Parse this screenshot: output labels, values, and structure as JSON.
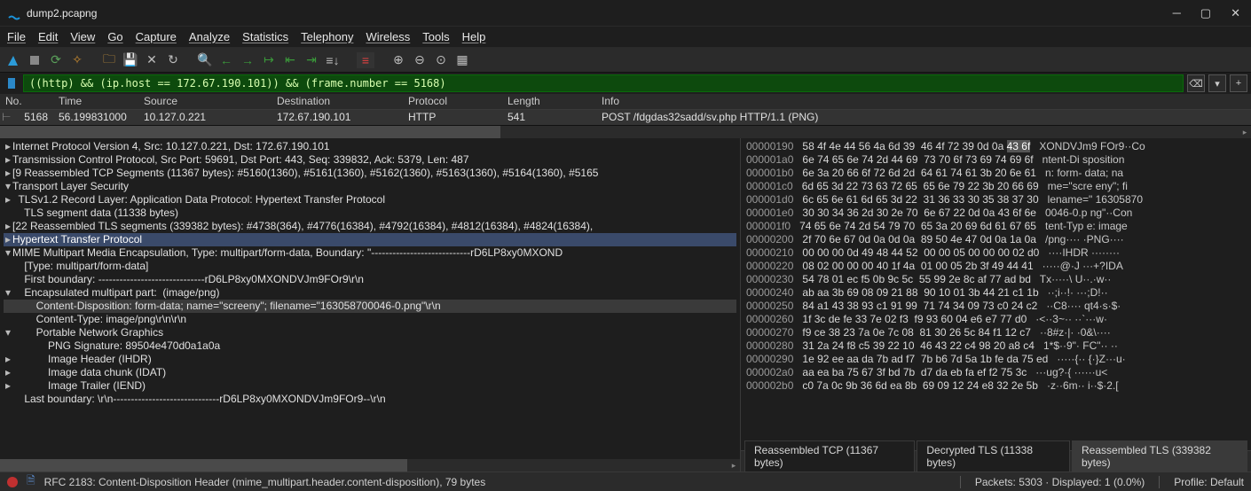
{
  "title": "dump2.pcapng",
  "menu": [
    "File",
    "Edit",
    "View",
    "Go",
    "Capture",
    "Analyze",
    "Statistics",
    "Telephony",
    "Wireless",
    "Tools",
    "Help"
  ],
  "filter": "((http) && (ip.host == 172.67.190.101)) && (frame.number == 5168)",
  "columns": [
    "No.",
    "Time",
    "Source",
    "Destination",
    "Protocol",
    "Length",
    "Info"
  ],
  "packetrow": {
    "no": "5168",
    "time": "56.199831000",
    "src": "10.127.0.221",
    "dst": "172.67.190.101",
    "proto": "HTTP",
    "len": "541",
    "info": "POST /fdgdas32sadd/sv.php HTTP/1.1   (PNG)"
  },
  "detail_lines": [
    {
      "twist": "▸",
      "indent": 0,
      "text": "Internet Protocol Version 4, Src: 10.127.0.221, Dst: 172.67.190.101",
      "cls": ""
    },
    {
      "twist": "▸",
      "indent": 0,
      "text": "Transmission Control Protocol, Src Port: 59691, Dst Port: 443, Seq: 339832, Ack: 5379, Len: 487",
      "cls": ""
    },
    {
      "twist": "▸",
      "indent": 0,
      "text": "[9 Reassembled TCP Segments (11367 bytes): #5160(1360), #5161(1360), #5162(1360), #5163(1360), #5164(1360), #5165",
      "cls": ""
    },
    {
      "twist": "▾",
      "indent": 0,
      "text": "Transport Layer Security",
      "cls": ""
    },
    {
      "twist": "▸",
      "indent": 2,
      "text": "TLSv1.2 Record Layer: Application Data Protocol: Hypertext Transfer Protocol",
      "cls": ""
    },
    {
      "twist": " ",
      "indent": 4,
      "text": "TLS segment data (11338 bytes)",
      "cls": ""
    },
    {
      "twist": "▸",
      "indent": 0,
      "text": "[22 Reassembled TLS segments (339382 bytes): #4738(364), #4776(16384), #4792(16384), #4812(16384), #4824(16384),",
      "cls": ""
    },
    {
      "twist": "▸",
      "indent": 0,
      "text": "Hypertext Transfer Protocol",
      "cls": "sel"
    },
    {
      "twist": "▾",
      "indent": 0,
      "text": "MIME Multipart Media Encapsulation, Type: multipart/form-data, Boundary: \"----------------------------rD6LP8xy0MXOND",
      "cls": ""
    },
    {
      "twist": " ",
      "indent": 4,
      "text": "[Type: multipart/form-data]",
      "cls": ""
    },
    {
      "twist": " ",
      "indent": 4,
      "text": "First boundary: ------------------------------rD6LP8xy0MXONDVJm9FOr9\\r\\n",
      "cls": ""
    },
    {
      "twist": "▾",
      "indent": 4,
      "text": "Encapsulated multipart part:  (image/png)",
      "cls": ""
    },
    {
      "twist": " ",
      "indent": 8,
      "text": "Content-Disposition: form-data; name=\"screeny\"; filename=\"163058700046-0.png\"\\r\\n",
      "cls": "hl"
    },
    {
      "twist": " ",
      "indent": 8,
      "text": "Content-Type: image/png\\r\\n\\r\\n",
      "cls": ""
    },
    {
      "twist": "▾",
      "indent": 8,
      "text": "Portable Network Graphics",
      "cls": ""
    },
    {
      "twist": " ",
      "indent": 12,
      "text": "PNG Signature: 89504e470d0a1a0a",
      "cls": ""
    },
    {
      "twist": "▸",
      "indent": 12,
      "text": "Image Header (IHDR)",
      "cls": ""
    },
    {
      "twist": "▸",
      "indent": 12,
      "text": "Image data chunk (IDAT)",
      "cls": ""
    },
    {
      "twist": "▸",
      "indent": 12,
      "text": "Image Trailer (IEND)",
      "cls": ""
    },
    {
      "twist": " ",
      "indent": 4,
      "text": "Last boundary: \\r\\n------------------------------rD6LP8xy0MXONDVJm9FOr9--\\r\\n",
      "cls": ""
    }
  ],
  "hex_lines": [
    {
      "off": "00000190",
      "hex": "58 4f 4e 44 56 4a 6d 39  46 4f 72 39 0d 0a 43 6f",
      "asc": "XONDVJm9 FOr9··Co"
    },
    {
      "off": "000001a0",
      "hex": "6e 74 65 6e 74 2d 44 69  73 70 6f 73 69 74 69 6f",
      "asc": "ntent-Di sposition"
    },
    {
      "off": "000001b0",
      "hex": "6e 3a 20 66 6f 72 6d 2d  64 61 74 61 3b 20 6e 61",
      "asc": "n: form- data; na"
    },
    {
      "off": "000001c0",
      "hex": "6d 65 3d 22 73 63 72 65  65 6e 79 22 3b 20 66 69",
      "asc": "me=\"scre eny\"; fi"
    },
    {
      "off": "000001d0",
      "hex": "6c 65 6e 61 6d 65 3d 22  31 36 33 30 35 38 37 30",
      "asc": "lename=\" 16305870"
    },
    {
      "off": "000001e0",
      "hex": "30 30 34 36 2d 30 2e 70  6e 67 22 0d 0a 43 6f 6e",
      "asc": "0046-0.p ng\"··Con"
    },
    {
      "off": "000001f0",
      "hex": "74 65 6e 74 2d 54 79 70  65 3a 20 69 6d 61 67 65",
      "asc": "tent-Typ e: image"
    },
    {
      "off": "00000200",
      "hex": "2f 70 6e 67 0d 0a 0d 0a  89 50 4e 47 0d 0a 1a 0a",
      "asc": "/png···· ·PNG····"
    },
    {
      "off": "00000210",
      "hex": "00 00 00 0d 49 48 44 52  00 00 05 00 00 00 02 d0",
      "asc": "····IHDR ········"
    },
    {
      "off": "00000220",
      "hex": "08 02 00 00 00 40 1f 4a  01 00 05 2b 3f 49 44 41",
      "asc": "·····@·J ···+?IDA"
    },
    {
      "off": "00000230",
      "hex": "54 78 01 ec f5 0b 9c 5c  55 99 2e 8c af 77 ad bd",
      "asc": "Tx·····\\ U··.·w··"
    },
    {
      "off": "00000240",
      "hex": "ab aa 3b 69 08 09 21 88  90 10 01 3b 44 21 c1 1b",
      "asc": "··;i··!· ···;D!··"
    },
    {
      "off": "00000250",
      "hex": "84 a1 43 38 93 c1 91 99  71 74 34 09 73 c0 24 c2",
      "asc": "··C8···· qt4·s·$·"
    },
    {
      "off": "00000260",
      "hex": "1f 3c de fe 33 7e 02 f3  f9 93 60 04 e6 e7 77 d0",
      "asc": "·<··3~·· ··`···w·"
    },
    {
      "off": "00000270",
      "hex": "f9 ce 38 23 7a 0e 7c 08  81 30 26 5c 84 f1 12 c7",
      "asc": "··8#z·|· ·0&\\····"
    },
    {
      "off": "00000280",
      "hex": "31 2a 24 f8 c5 39 22 10  46 43 22 c4 98 20 a8 c4",
      "asc": "1*$··9\"· FC\"·· ··"
    },
    {
      "off": "00000290",
      "hex": "1e 92 ee aa da 7b ad f7  7b b6 7d 5a 1b fe da 75 ed",
      "asc": "·····{·· {·}Z···u·"
    },
    {
      "off": "000002a0",
      "hex": "aa ea ba 75 67 3f bd 7b  d7 da eb fa ef f2 75 3c",
      "asc": "···ug?·{ ······u<"
    },
    {
      "off": "000002b0",
      "hex": "c0 7a 0c 9b 36 6d ea 8b  69 09 12 24 e8 32 2e 5b",
      "asc": "·z··6m·· i··$·2.["
    }
  ],
  "hex_tabs": [
    {
      "label": "Reassembled TCP (11367 bytes)",
      "active": false
    },
    {
      "label": "Decrypted TLS (11338 bytes)",
      "active": false
    },
    {
      "label": "Reassembled TLS (339382 bytes)",
      "active": true
    }
  ],
  "status_field": "RFC 2183: Content-Disposition Header (mime_multipart.header.content-disposition), 79 bytes",
  "status_packets": "Packets: 5303 · Displayed: 1 (0.0%)",
  "status_profile": "Profile: Default"
}
